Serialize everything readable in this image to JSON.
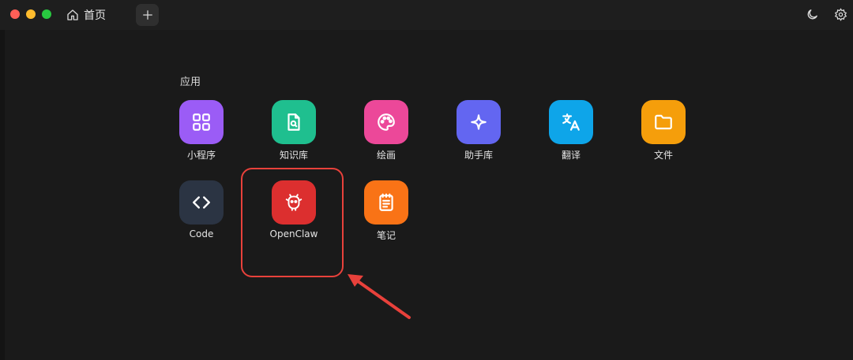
{
  "tab": {
    "label": "首页",
    "icon": "home-icon"
  },
  "toolbar": {
    "new_tab_icon": "plus-icon",
    "theme_icon": "moon-icon",
    "settings_icon": "gear-icon"
  },
  "section": {
    "title": "应用"
  },
  "apps": [
    {
      "label": "小程序",
      "icon": "grid-icon",
      "color": "#9b5cf6"
    },
    {
      "label": "知识库",
      "icon": "file-search-icon",
      "color": "#1fbf8f"
    },
    {
      "label": "绘画",
      "icon": "palette-icon",
      "color": "#ec4899"
    },
    {
      "label": "助手库",
      "icon": "sparkle-icon",
      "color": "#6366f1"
    },
    {
      "label": "翻译",
      "icon": "translate-icon",
      "color": "#0ea5e9"
    },
    {
      "label": "文件",
      "icon": "folder-icon",
      "color": "#f59e0b"
    },
    {
      "label": "Code",
      "icon": "code-icon",
      "color": "#2b3443"
    },
    {
      "label": "OpenClaw",
      "icon": "openclaw-icon",
      "color": "#dc2f2f"
    },
    {
      "label": "笔记",
      "icon": "notepad-icon",
      "color": "#f97316"
    }
  ],
  "annotation": {
    "highlight_color": "#e8413b",
    "highlighted_app": "OpenClaw"
  }
}
